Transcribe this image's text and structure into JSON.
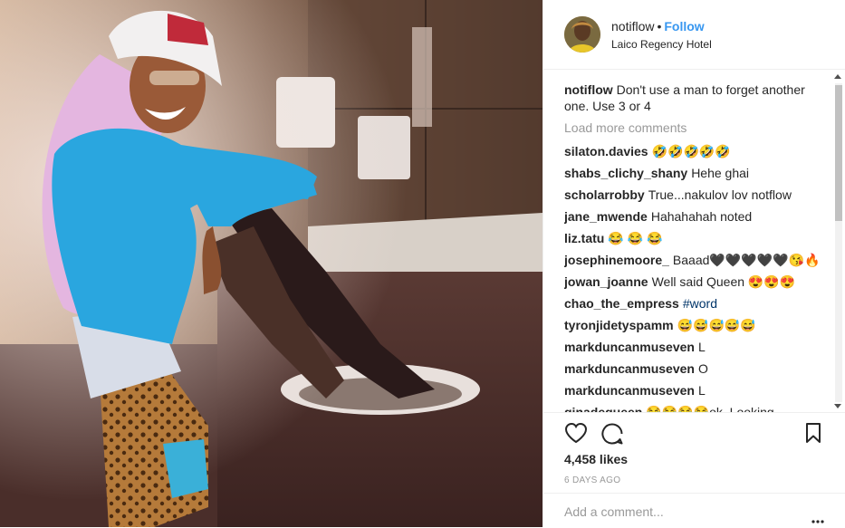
{
  "post": {
    "username": "notiflow",
    "separator": "•",
    "follow_label": "Follow",
    "location": "Laico Regency Hotel",
    "caption": "Don't use a man to forget another one. Use 3 or 4",
    "load_more_label": "Load more comments",
    "likes": "4,458 likes",
    "time_ago": "6 DAYS AGO",
    "comment_placeholder": "Add a comment..."
  },
  "comments": [
    {
      "user": "silaton.davies",
      "text": "🤣🤣🤣🤣🤣"
    },
    {
      "user": "shabs_clichy_shany",
      "text": "Hehe ghai"
    },
    {
      "user": "scholarrobby",
      "text": "True...nakulov lov notflow"
    },
    {
      "user": "jane_mwende",
      "text": "Hahahahah noted"
    },
    {
      "user": "liz.tatu",
      "text": "😂 😂 😂"
    },
    {
      "user": "josephinemoore_",
      "text": "Baaad🖤🖤🖤🖤🖤😘🔥"
    },
    {
      "user": "jowan_joanne",
      "text": "Well said Queen 😍😍😍"
    },
    {
      "user": "chao_the_empress",
      "text": "#word"
    },
    {
      "user": "tyronjidetyspamm",
      "text": "😅😅😅😅😅"
    },
    {
      "user": "markduncanmuseven",
      "text": "L"
    },
    {
      "user": "markduncanmuseven",
      "text": "O"
    },
    {
      "user": "markduncanmuseven",
      "text": "L"
    },
    {
      "user": "ginadequeen",
      "text": "😂😂😂😂ok. Looking"
    }
  ],
  "icons": {
    "like": "heart-icon",
    "comment": "comment-icon",
    "save": "bookmark-icon",
    "more": "more-options-icon"
  },
  "colors": {
    "follow": "#3897f0",
    "text": "#262626",
    "muted": "#999999",
    "hashtag": "#003569",
    "border": "#efefef"
  }
}
